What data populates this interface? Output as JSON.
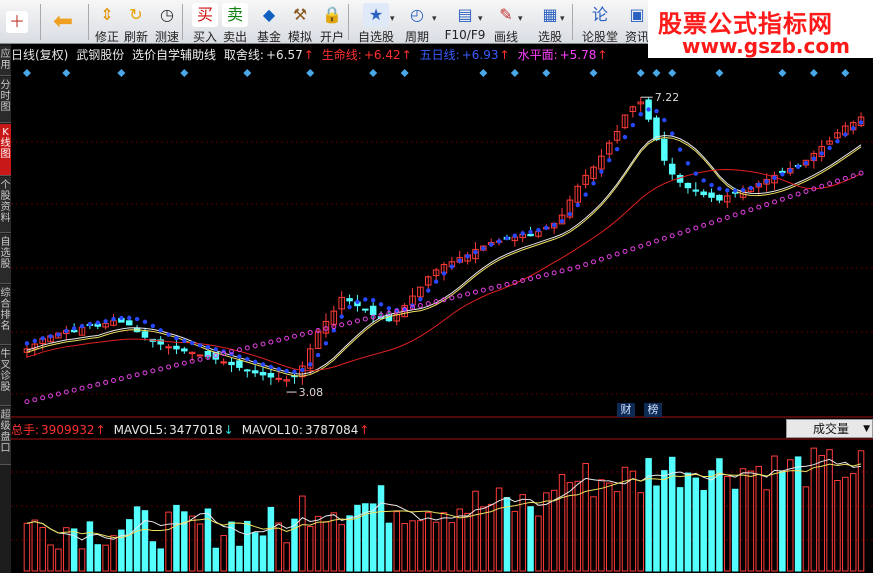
{
  "toolbar": {
    "buttons": [
      {
        "label": "",
        "icon": "add-window-icon",
        "x": 2
      },
      {
        "label": "",
        "icon": "back-arrow-icon",
        "x": 48
      },
      {
        "label": "修正",
        "icon": "up-down-arrow-icon",
        "x": 92
      },
      {
        "label": "刷新",
        "icon": "refresh-icon",
        "x": 121
      },
      {
        "label": "测速",
        "icon": "clock-icon",
        "x": 152
      },
      {
        "label": "买入",
        "icon": "buy-icon",
        "x": 190
      },
      {
        "label": "卖出",
        "icon": "sell-icon",
        "x": 220
      },
      {
        "label": "基金",
        "icon": "fund-icon",
        "x": 254
      },
      {
        "label": "模拟",
        "icon": "gavel-icon",
        "x": 285
      },
      {
        "label": "开户",
        "icon": "lock-icon",
        "x": 317
      },
      {
        "label": "自选股",
        "icon": "star-folder-icon",
        "x": 354
      },
      {
        "label": "周期",
        "icon": "period-clock-icon",
        "x": 402
      },
      {
        "label": "F10/F9",
        "icon": "f10-icon",
        "x": 443
      },
      {
        "label": "画线",
        "icon": "pen-icon",
        "x": 491
      },
      {
        "label": "选股",
        "icon": "screen-icon",
        "x": 535
      },
      {
        "label": "论股堂",
        "icon": "discuss-icon",
        "x": 578
      },
      {
        "label": "资讯",
        "icon": "news-icon",
        "x": 622
      }
    ]
  },
  "logo": {
    "line1": "股票公式指标网",
    "line2": "www.gszb.com"
  },
  "left_tabs": [
    {
      "label": "应用",
      "active": false
    },
    {
      "label": "分时图",
      "active": false
    },
    {
      "label": "K线图",
      "active": true
    },
    {
      "label": "个股资料",
      "active": false
    },
    {
      "label": "自选股",
      "active": false
    },
    {
      "label": "综合排名",
      "active": false
    },
    {
      "label": "牛叉诊股",
      "active": false
    },
    {
      "label": "超级盘口",
      "active": false
    }
  ],
  "info": {
    "period": "日线(复权)",
    "stock": "武钢股份",
    "formula": "选价自学辅助线",
    "items": [
      {
        "label": "取舍线:",
        "value": "+6.57",
        "arrow": "↑",
        "color": "#e6e6e6",
        "arrowColor": "#ff3030"
      },
      {
        "label": "生命线:",
        "value": "+6.42",
        "arrow": "↑",
        "color": "#ff3030",
        "arrowColor": "#ff3030"
      },
      {
        "label": "五日线:",
        "value": "+6.93",
        "arrow": "↑",
        "color": "#3a5cff",
        "arrowColor": "#ff3030"
      },
      {
        "label": "水平面:",
        "value": "+5.78",
        "arrow": "↑",
        "color": "#ff40ff",
        "arrowColor": "#ff3030"
      }
    ]
  },
  "volume_info": {
    "items": [
      {
        "label": "总手:",
        "value": "3909932",
        "arrow": "↑",
        "color": "#ff3030",
        "arrowColor": "#ff3030"
      },
      {
        "label": "MAVOL5:",
        "value": "3477018",
        "arrow": "↓",
        "color": "#e6e6e6",
        "arrowColor": "#30e0e0"
      },
      {
        "label": "MAVOL10:",
        "value": "3787084",
        "arrow": "↑",
        "color": "#e6e6e6",
        "arrowColor": "#ff3030"
      }
    ],
    "selector": "成交量"
  },
  "badges": [
    "财",
    "榜"
  ],
  "colors": {
    "up": "#ff3b3b",
    "down": "#54ffff",
    "ma_white": "#e8e8e8",
    "ma_yellow": "#f0e060",
    "ma_red": "#e02020",
    "dots_blue": "#2848ff",
    "circles": "#e040e0",
    "diamond": "#4aa8e8"
  },
  "chart_data": {
    "type": "candlestick",
    "stock": "武钢股份",
    "period": "日线(复权)",
    "annotations": [
      {
        "text": "7.22",
        "kind": "high"
      },
      {
        "text": "3.08",
        "kind": "low"
      }
    ],
    "price_range": [
      2.6,
      7.5
    ],
    "closes": [
      3.55,
      3.62,
      3.7,
      3.74,
      3.78,
      3.82,
      3.8,
      3.86,
      3.9,
      3.88,
      3.92,
      3.96,
      3.94,
      3.9,
      3.8,
      3.72,
      3.66,
      3.62,
      3.58,
      3.55,
      3.52,
      3.5,
      3.46,
      3.44,
      3.4,
      3.36,
      3.32,
      3.28,
      3.24,
      3.2,
      3.17,
      3.14,
      3.12,
      3.1,
      3.15,
      3.3,
      3.55,
      3.8,
      3.95,
      4.1,
      4.3,
      4.25,
      4.18,
      4.12,
      4.05,
      4.0,
      3.96,
      4.05,
      4.18,
      4.32,
      4.45,
      4.6,
      4.7,
      4.78,
      4.82,
      4.88,
      4.92,
      5.0,
      5.05,
      5.1,
      5.12,
      5.15,
      5.18,
      5.22,
      5.2,
      5.26,
      5.32,
      5.38,
      5.5,
      5.72,
      5.92,
      6.08,
      6.2,
      6.36,
      6.55,
      6.72,
      6.96,
      7.08,
      7.15,
      6.9,
      6.6,
      6.3,
      6.1,
      5.98,
      5.9,
      5.85,
      5.8,
      5.76,
      5.72,
      5.78,
      5.82,
      5.86,
      5.9,
      5.96,
      6.02,
      6.08,
      6.12,
      6.18,
      6.22,
      6.3,
      6.4,
      6.5,
      6.58,
      6.7,
      6.8,
      6.85,
      6.93
    ],
    "volume": {
      "series": [
        "总手",
        "MAVOL5",
        "MAVOL10"
      ],
      "last": [
        3909932,
        3477018,
        3787084
      ]
    }
  }
}
